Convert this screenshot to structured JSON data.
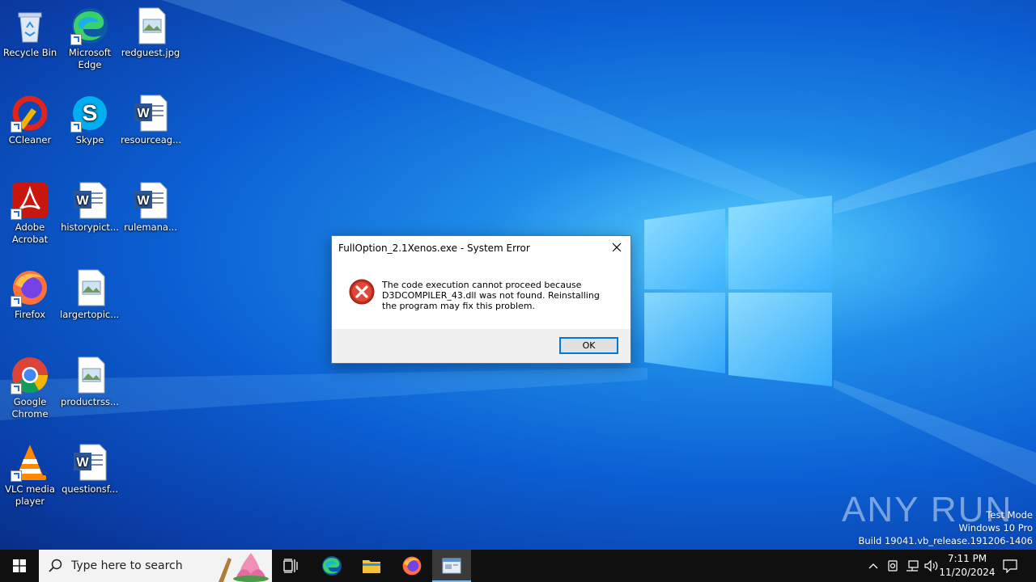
{
  "desktop_icons": [
    {
      "label": "Recycle Bin",
      "icon": "recycle-bin-icon"
    },
    {
      "label": "Microsoft Edge",
      "icon": "edge-icon"
    },
    {
      "label": "redguest.jpg",
      "icon": "image-file-icon"
    },
    {
      "label": "CCleaner",
      "icon": "ccleaner-icon"
    },
    {
      "label": "Skype",
      "icon": "skype-icon"
    },
    {
      "label": "resourceag...",
      "icon": "word-doc-icon"
    },
    {
      "label": "Adobe Acrobat",
      "icon": "acrobat-icon"
    },
    {
      "label": "historypict...",
      "icon": "word-doc-icon"
    },
    {
      "label": "rulemana...",
      "icon": "word-doc-icon"
    },
    {
      "label": "Firefox",
      "icon": "firefox-icon"
    },
    {
      "label": "largertopic....",
      "icon": "image-file-icon"
    },
    {
      "label": "Google Chrome",
      "icon": "chrome-icon"
    },
    {
      "label": "productrss...",
      "icon": "image-file-icon"
    },
    {
      "label": "VLC media player",
      "icon": "vlc-icon"
    },
    {
      "label": "questionsf...",
      "icon": "word-doc-icon"
    }
  ],
  "dialog": {
    "title": "FullOption_2.1Xenos.exe - System Error",
    "message": "The code execution cannot proceed because D3DCOMPILER_43.dll was not found. Reinstalling the program may fix this problem.",
    "ok_label": "OK"
  },
  "watermark": {
    "brand": "ANY RUN",
    "line1": "Test Mode",
    "line2": "Windows 10 Pro",
    "line3": "Build 19041.vb_release.191206-1406"
  },
  "taskbar": {
    "search_placeholder": "Type here to search",
    "time": "7:11 PM",
    "date": "11/20/2024",
    "accent": "#76b9ed"
  }
}
